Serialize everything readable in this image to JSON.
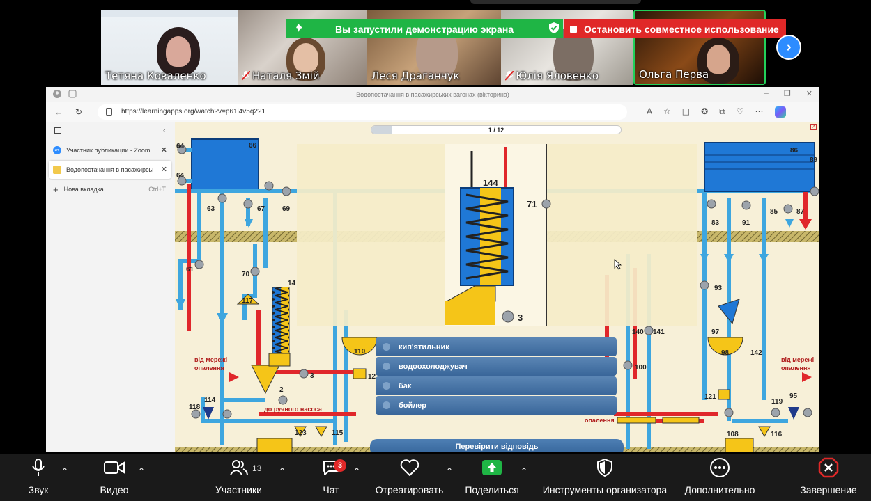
{
  "participants": [
    {
      "name": "Тетяна  Коваленко",
      "muted": false,
      "active": false
    },
    {
      "name": "Наталя Змій",
      "muted": true,
      "active": false
    },
    {
      "name": "Леся Драганчук",
      "muted": false,
      "active": false
    },
    {
      "name": "Юлія Яловенко",
      "muted": true,
      "active": false
    },
    {
      "name": "Ольга Перва",
      "muted": false,
      "active": true
    }
  ],
  "share_banner": {
    "status": "Вы запустили демонстрацию экрана",
    "stop_label": "Остановить совместное использование"
  },
  "browser": {
    "window_title": "Водопостачання в пасажирських вагонах (вікторина)",
    "url": "https://learningapps.org/watch?v=p61i4v5q221",
    "tabs": [
      {
        "title": "Участник публикации - Zoom",
        "icon": "zoom-icon",
        "active": false
      },
      {
        "title": "Водопостачання в пасажирськ",
        "icon": "learningapps-icon",
        "active": true
      }
    ],
    "new_tab_label": "Нова вкладка",
    "new_tab_shortcut": "Ctrl+T"
  },
  "quiz": {
    "progress_text": "1 / 12",
    "progress_fraction": 0.08,
    "answers": [
      "кип'ятильник",
      "водоохолоджувач",
      "бак",
      "бойлер"
    ],
    "check_button": "Перевірити відповідь",
    "diagram_labels": {
      "l64a": "64",
      "l66": "66",
      "l64b": "64",
      "l63": "63",
      "l67": "67",
      "l69": "69",
      "l61": "61",
      "l70": "70",
      "l117": "117",
      "l14": "14",
      "l3a": "3",
      "l110": "110",
      "l12": "12",
      "l2": "2",
      "l118": "118",
      "l114": "114",
      "l123": "123",
      "l115": "115",
      "heat_left": "від мережі опалення",
      "manual_pump": "до ручного насоса",
      "zoom144": "144",
      "zoom71": "71",
      "zoom3": "3",
      "l86": "86",
      "l89": "89",
      "l83": "83",
      "l91": "91",
      "l85": "85",
      "l87": "87",
      "l93": "93",
      "l97": "97",
      "l98": "98",
      "l142": "142",
      "l140": "140",
      "l141": "141",
      "l100": "100",
      "l121": "121",
      "l119": "119",
      "l95": "95",
      "l108": "108",
      "l116": "116",
      "heat_right": "від мережі опалення",
      "heating": "опалення"
    }
  },
  "toolbar": {
    "audio": "Звук",
    "video": "Видео",
    "participants": "Участники",
    "participants_count": "13",
    "chat": "Чат",
    "chat_badge": "3",
    "react": "Отреагировать",
    "share": "Поделиться",
    "host_tools": "Инструменты организатора",
    "more": "Дополнительно",
    "end": "Завершение"
  },
  "colors": {
    "share_green": "#1fb545",
    "stop_red": "#e02828",
    "zoom_blue": "#2d8cff",
    "answer_blue": "#3f6c9f",
    "pipe_blue": "#3ea6df",
    "tank_blue": "#1f78d6",
    "heat_yellow": "#f5c518",
    "hot_red": "#e0272b"
  }
}
